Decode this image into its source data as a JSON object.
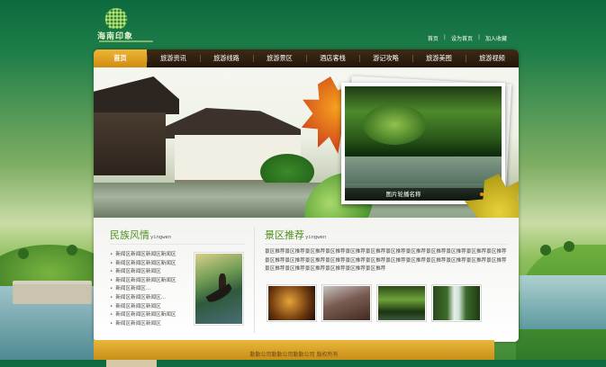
{
  "logo": {
    "text": "海南印象"
  },
  "top_links": [
    "首页",
    "设为首页",
    "加入收藏"
  ],
  "nav": {
    "items": [
      "首页",
      "旅游资讯",
      "旅游线路",
      "旅游景区",
      "酒店客栈",
      "游记攻略",
      "旅游美图",
      "旅游视频"
    ],
    "active_index": 0
  },
  "slideshow": {
    "caption": "图片轮播名称",
    "dot_count": 3,
    "active_dot": 0
  },
  "ethnic": {
    "title": "民族风情",
    "subtitle": "yingwen",
    "items": [
      "新闻区新闻区新闻区新闻区",
      "新闻区新闻区新闻区新闻区",
      "新闻区新闻区新闻区",
      "新闻区新闻区新闻区新闻区",
      "新闻区新闻区...",
      "新闻区新闻区新闻区...",
      "新闻区新闻区新闻区",
      "新闻区新闻区新闻区新闻区",
      "新闻区新闻区新闻区"
    ]
  },
  "scenic": {
    "title": "景区推荐",
    "subtitle": "yingwen",
    "text": "景区推荐景区推荐景区推荐景区推荐景区推荐景区推荐景区推荐景区推荐景区推荐景区推荐景区推荐景区推荐景区推荐景区推荐景区推荐景区推荐景区推荐景区推荐景区推荐景区推荐景区推荐景区推荐景区推荐景区推荐景区推荐景区推荐景区推荐景区推荐景区推荐景区推荐"
  },
  "footer": {
    "text": "勤勤公司勤勤公司勤勤公司   版权所有"
  }
}
